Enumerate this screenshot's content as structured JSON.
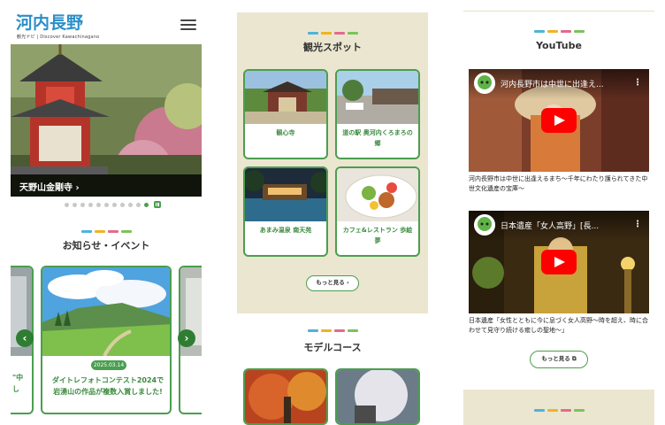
{
  "colors": {
    "green": "#4b9e4f",
    "beige": "#ebe6d0",
    "bars": [
      "#4fb3d9",
      "#f0b323",
      "#e46a8c",
      "#7cc35a"
    ]
  },
  "panel1": {
    "logo_text": "河内長野",
    "logo_sub": "観光ナビ | Discover Kawachinagano",
    "menu_icon": "hamburger-icon",
    "hero_caption": "天野山金剛寺 ›",
    "slide_count": 12,
    "active_slide": 1,
    "news_title": "お知らせ・イベント",
    "news_card": {
      "date": "2025.03.14",
      "title": "ダイトレフォトコンテスト2024で岩湧山の作品が複数入賞しました!"
    },
    "left_card_fragment": "\"中\nし"
  },
  "panel2": {
    "spots_title": "観光スポット",
    "spots": [
      {
        "label": "観心寺"
      },
      {
        "label": "道の駅 奥河内くろまろの郷"
      },
      {
        "label": "あまみ温泉 南天苑"
      },
      {
        "label": "カフェ&レストラン 歩絵夢"
      }
    ],
    "more_label": "もっと見る ›",
    "course_title": "モデルコース"
  },
  "panel3": {
    "youtube_title": "YouTube",
    "videos": [
      {
        "title": "河内長野市は中世に出逢え...",
        "desc": "河内長野市は中世に出逢えるまち～千年にわたり護られてきた中世文化遺産の宝庫～"
      },
      {
        "title": "日本遺産「女人高野」[長...",
        "desc": "日本遺産「女性とともに今に息づく女人高野～時を超え、時に合わせて見守り続ける癒しの聖地～」"
      }
    ],
    "more_label": "もっと見る ⧉"
  }
}
